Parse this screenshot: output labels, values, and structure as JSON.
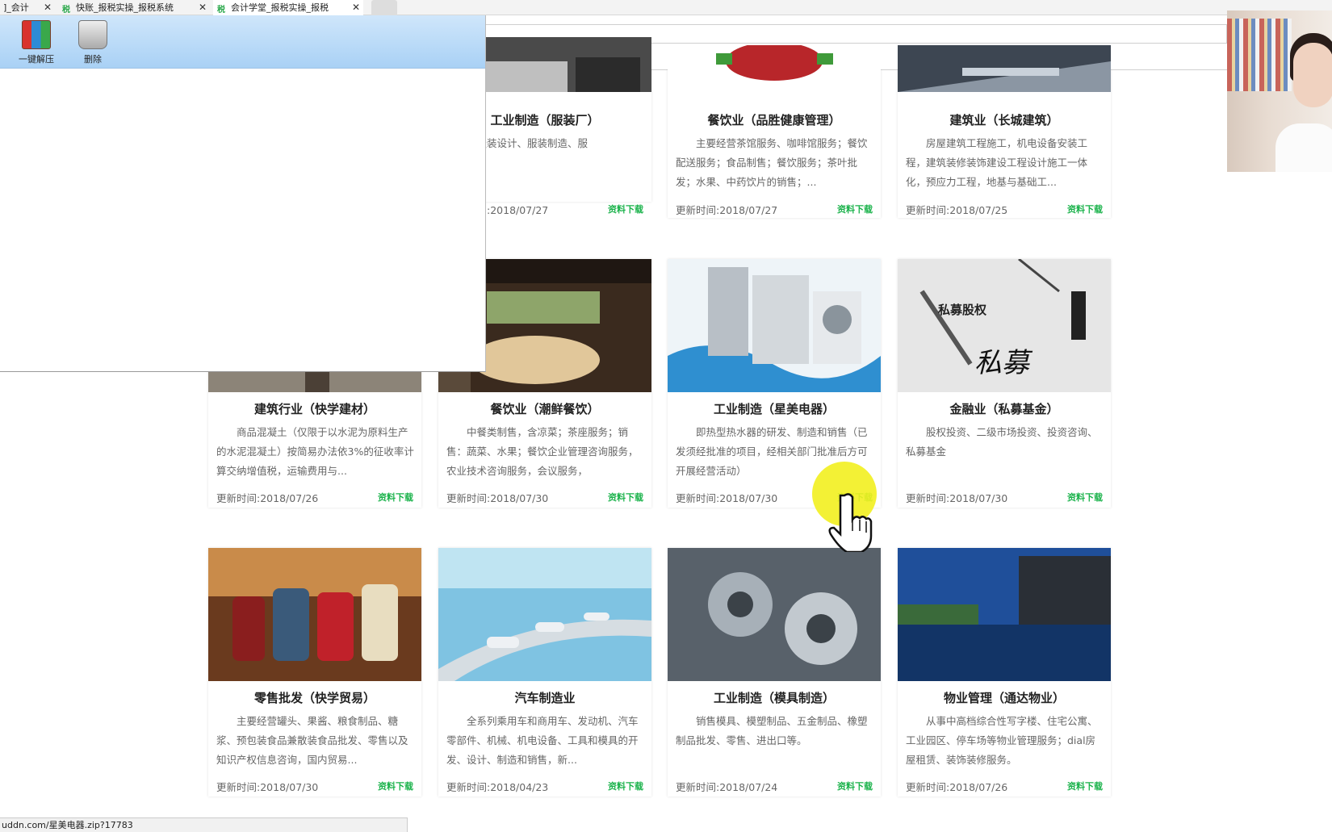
{
  "browser": {
    "tabs": [
      {
        "label": "]_会计",
        "icon": ""
      },
      {
        "label": "快账_报税实操_报税系统",
        "icon": "税"
      },
      {
        "label": "会计学堂_报税实操_报税",
        "icon": "税"
      }
    ],
    "status_url": "uddn.com/星美电器.zip?17783"
  },
  "archive_panel": {
    "tools": [
      {
        "label": "一键解压",
        "icon": "winrar-icon"
      },
      {
        "label": "删除",
        "icon": "recycle-bin-icon"
      }
    ]
  },
  "download_label": "资料下载",
  "date_prefix": "更新时间:",
  "cards": [
    {
      "title": "工业制造（服装厂）",
      "desc": "要经营服装设计、服装制造、服\n装销售。",
      "date": "2018/07/27",
      "img": "clothing-factory-photo"
    },
    {
      "title": "餐饮业（品胜健康管理）",
      "desc": "主要经营茶馆服务、咖啡馆服务；餐饮配送服务；食品制售；餐饮服务；茶叶批发；水果、中药饮片的销售；...",
      "date": "2018/07/27",
      "img": "food-photo"
    },
    {
      "title": "建筑业（长城建筑）",
      "desc": "房屋建筑工程施工，机电设备安装工程，建筑装修装饰建设工程设计施工一体化，预应力工程，地基与基础工...",
      "date": "2018/07/25",
      "img": "construction-photo"
    },
    {
      "title": "建筑行业（快学建材）",
      "desc": "商品混凝土（仅限于以水泥为原料生产的水泥混凝土）按简易办法依3%的征收率计算交纳增值税，运输费用与...",
      "date": "2018/07/26",
      "img": "building-interior-photo"
    },
    {
      "title": "餐饮业（潮鲜餐饮）",
      "desc": "中餐类制售，含凉菜；茶座服务；销售：蔬菜、水果；餐饮企业管理咨询服务，农业技术咨询服务，会议服务，",
      "date": "2018/07/30",
      "img": "restaurant-photo"
    },
    {
      "title": "工业制造（星美电器）",
      "desc": "即热型热水器的研发、制造和销售（已发须经批准的项目，经相关部门批准后方可开展经营活动）",
      "date": "2018/07/30",
      "img": "appliances-photo"
    },
    {
      "title": "金融业（私募基金）",
      "desc": "股权投资、二级市场投资、投资咨询、私募基金",
      "date": "2018/07/30",
      "img": "private-equity-photo",
      "img_text": [
        "私募股权",
        "私募"
      ]
    },
    {
      "title": "零售批发（快学贸易）",
      "desc": "主要经营罐头、果酱、粮食制品、糖浆、预包装食品兼散装食品批发、零售以及知识产权信息咨询，国内贸易...",
      "date": "2018/07/30",
      "img": "candles-photo"
    },
    {
      "title": "汽车制造业",
      "desc": "全系列乘用车和商用车、发动机、汽车零部件、机械、机电设备、工具和模具的开发、设计、制造和销售，新...",
      "date": "2018/04/23",
      "img": "cars-photo"
    },
    {
      "title": "工业制造（模具制造）",
      "desc": "销售模具、模塑制品、五金制品、橡塑制品批发、零售、进出口等。",
      "date": "2018/07/24",
      "img": "engine-gears-photo"
    },
    {
      "title": "物业管理（通达物业）",
      "desc": "从事中高档综合性写字楼、住宅公寓、工业园区、停车场等物业管理服务；dial房屋租赁、装饰装修服务。",
      "date": "2018/07/26",
      "img": "office-building-photo"
    }
  ]
}
